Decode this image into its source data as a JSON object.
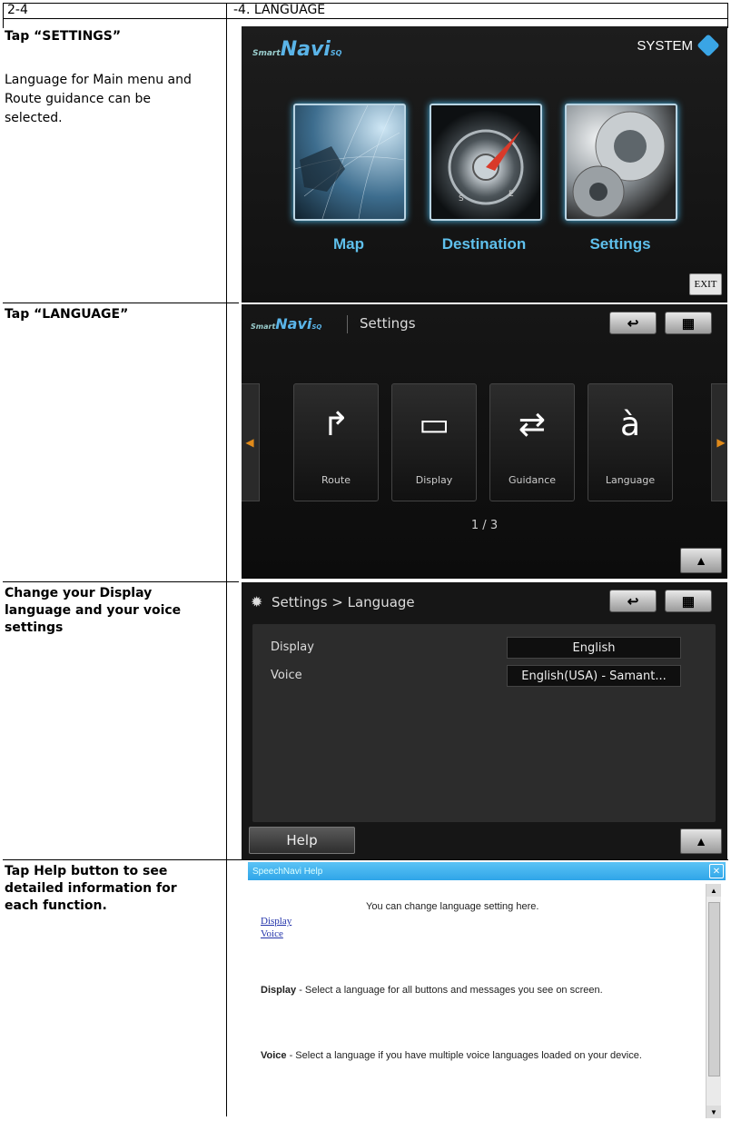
{
  "header": {
    "left": "2-4",
    "right": "-4. LANGUAGE"
  },
  "rows": [
    {
      "title": "Tap “SETTINGS”",
      "desc": "Language for Main menu and Route guidance can be selected."
    },
    {
      "title": "Tap “LANGUAGE”"
    },
    {
      "title": "Change your Display language and your voice settings"
    },
    {
      "title": "Tap Help button to see detailed information for each function."
    }
  ],
  "screen1": {
    "logo_prefix": "Smart",
    "logo_main": "Navi",
    "logo_suffix": "SQ",
    "system_label": "SYSTEM",
    "tiles": [
      "Map",
      "Destination",
      "Settings"
    ],
    "exit_label": "EXIT"
  },
  "screen2": {
    "title": "Settings",
    "back_icon": "↩",
    "menu_icon": "▦",
    "cards": [
      "Route",
      "Display",
      "Guidance",
      "Language"
    ],
    "pager": "1 / 3",
    "up_icon": "▲"
  },
  "screen3": {
    "title": "Settings > Language",
    "rows": [
      {
        "label": "Display",
        "value": "English"
      },
      {
        "label": "Voice",
        "value": "English(USA) - Samant..."
      }
    ],
    "help_label": "Help"
  },
  "screen4": {
    "window_title": "SpeechNavi Help",
    "intro": "You can change language setting here.",
    "links": [
      "Display",
      "Voice"
    ],
    "display_term": "Display",
    "display_text": " - Select a language for all buttons and messages you see on screen.",
    "voice_term": "Voice",
    "voice_text": " - Select a language if you have multiple voice languages loaded on your device."
  }
}
